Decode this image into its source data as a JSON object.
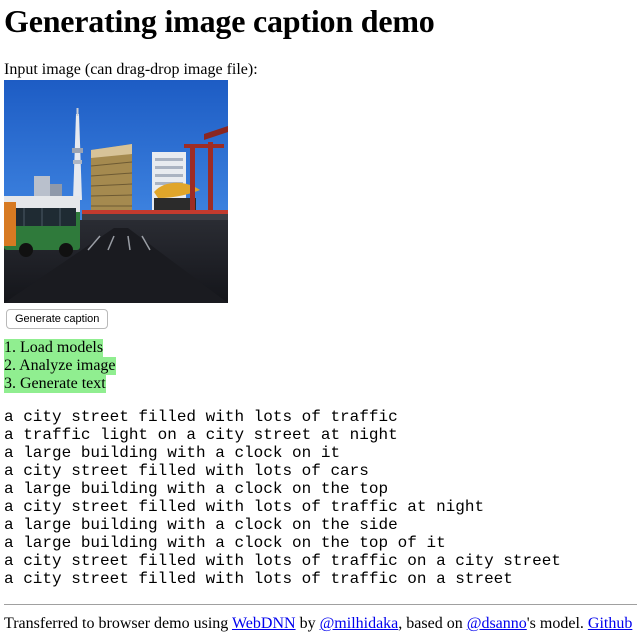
{
  "header": {
    "title": "Generating image caption demo"
  },
  "input": {
    "label": "Input image (can drag-drop image file):"
  },
  "controls": {
    "generate_label": "Generate caption"
  },
  "steps": [
    "1. Load models",
    "2. Analyze image",
    "3. Generate text"
  ],
  "captions": [
    "a city street filled with lots of traffic",
    "a traffic light on a city street at night",
    "a large building with a clock on it",
    "a city street filled with lots of cars",
    "a large building with a clock on the top",
    "a city street filled with lots of traffic at night",
    "a large building with a clock on the side",
    "a large building with a clock on the top of it",
    "a city street filled with lots of traffic on a city street",
    "a city street filled with lots of traffic on a street"
  ],
  "footer": {
    "prefix": "Transferred to browser demo using ",
    "webdnn_link": "WebDNN",
    "by_text": " by ",
    "author_link": "@milhidaka",
    "based_text": ", based on ",
    "model_author_link": "@dsanno",
    "model_text": "'s model. ",
    "github_link": "Github"
  },
  "colors": {
    "step_highlight": "#90ee90",
    "link": "#0000ee",
    "sky": "#2d6fd1"
  }
}
